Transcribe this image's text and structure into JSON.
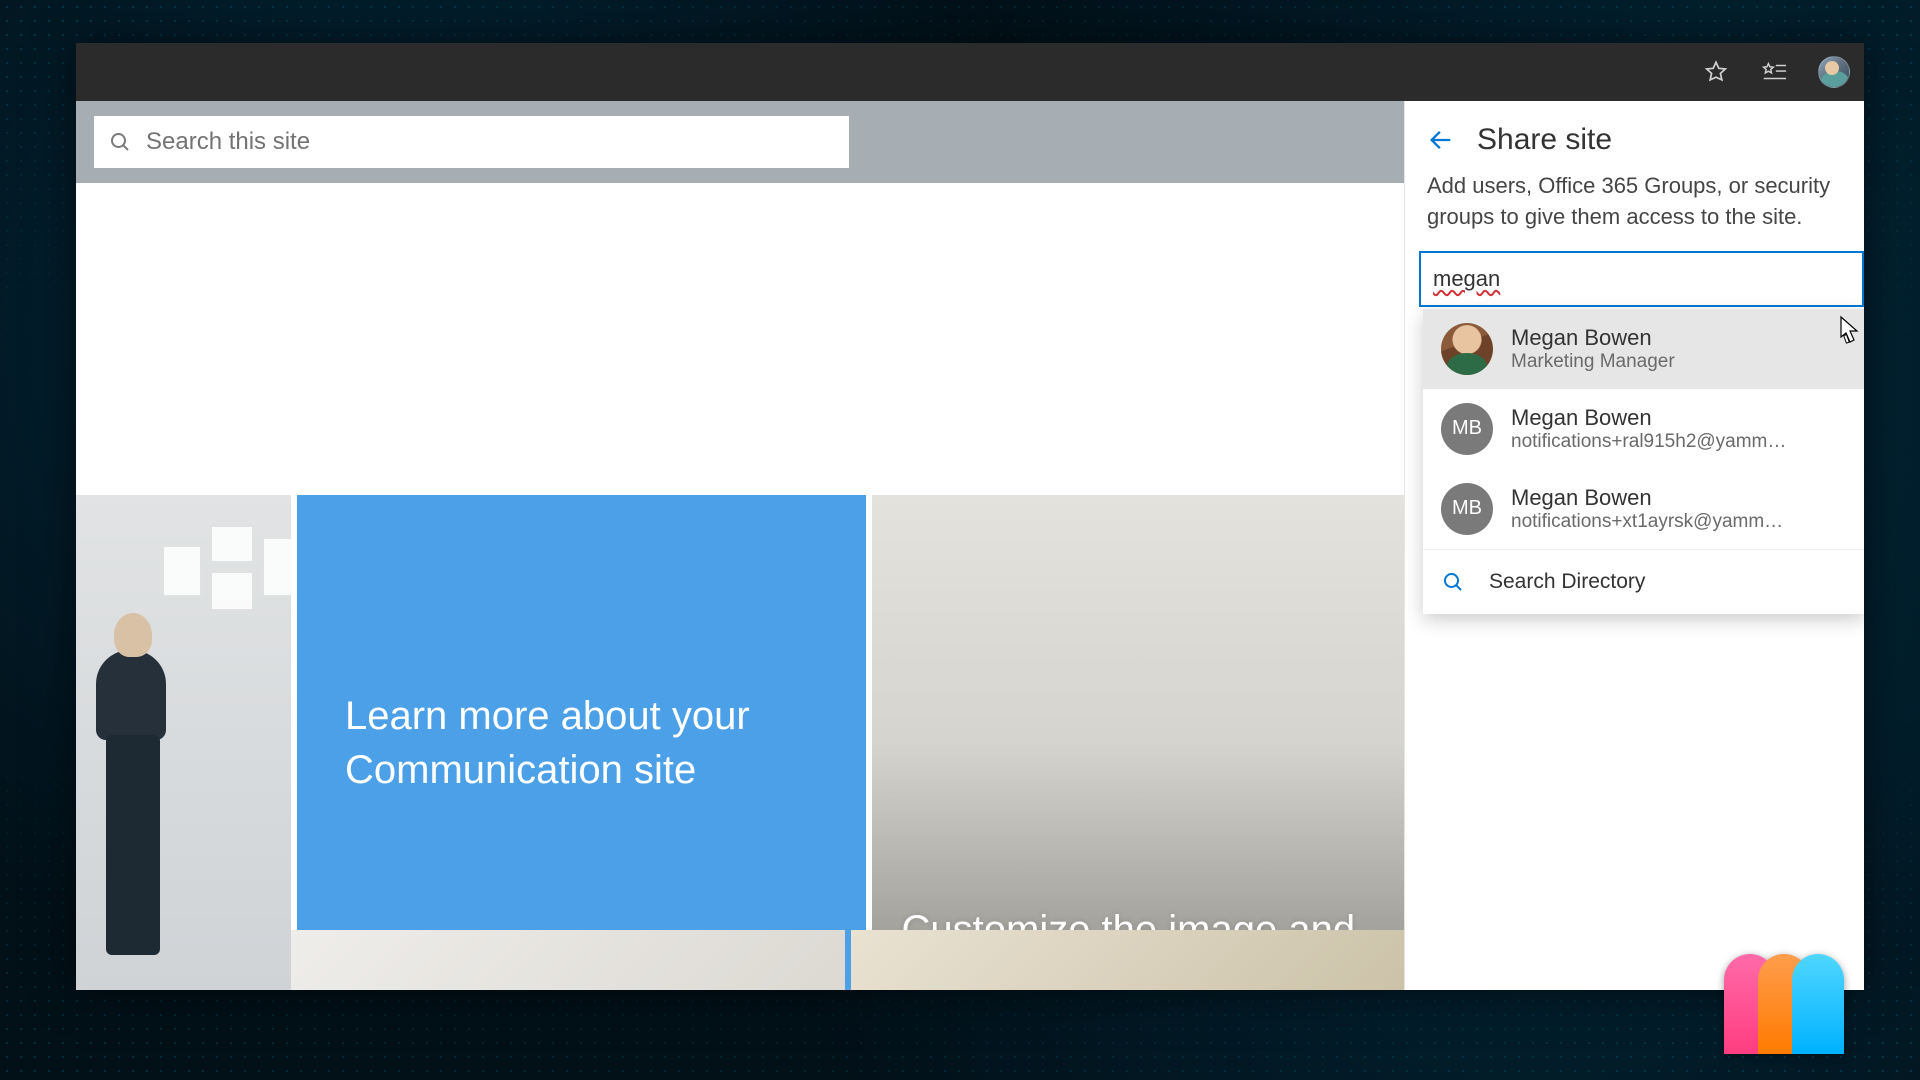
{
  "search": {
    "placeholder": "Search this site"
  },
  "hero": {
    "center_text": "Learn more about your Communication site",
    "right_text": "Customize the image and li"
  },
  "share_panel": {
    "title": "Share site",
    "description": "Add users, Office 365 Groups, or security groups to give them access to the site.",
    "input_value": "megan",
    "suggestions": [
      {
        "name": "Megan Bowen",
        "subtitle": "Marketing Manager",
        "initials": "",
        "photo": true
      },
      {
        "name": "Megan Bowen",
        "subtitle": "notifications+ral915h2@yamm…",
        "initials": "MB",
        "photo": false
      },
      {
        "name": "Megan Bowen",
        "subtitle": "notifications+xt1ayrsk@yamm…",
        "initials": "MB",
        "photo": false
      }
    ],
    "search_directory_label": "Search Directory"
  }
}
